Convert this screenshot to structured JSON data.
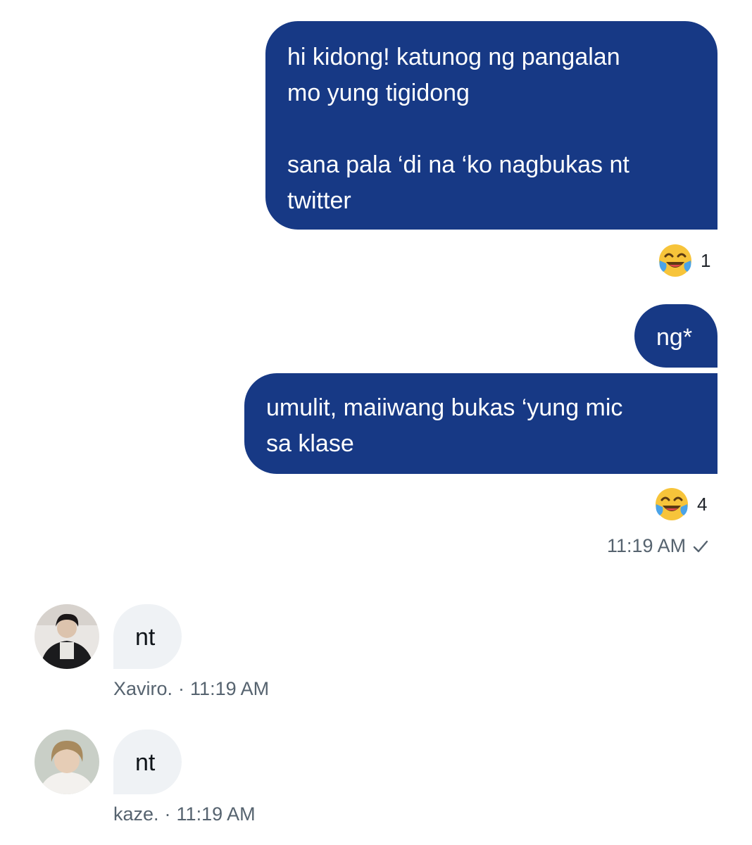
{
  "messages_sent": [
    {
      "text": "hi kidong! katunog ng pangalan\nmo yung tigidong\n\nsana pala ‘di na ‘ko nagbukas nt\ntwitter"
    },
    {
      "text": "ng*"
    },
    {
      "text": "umulit, maiiwang bukas ‘yung mic\nsa klase"
    }
  ],
  "reactions": [
    {
      "emoji": "face-with-tears-of-joy-icon",
      "count": "1"
    },
    {
      "emoji": "face-with-tears-of-joy-icon",
      "count": "4"
    }
  ],
  "sent_timestamp": "11:19 AM",
  "messages_received": [
    {
      "sender": "Xaviro.",
      "separator": "·",
      "time": "11:19 AM",
      "text": "nt"
    },
    {
      "sender": "kaze.",
      "separator": "·",
      "time": "11:19 AM",
      "text": "nt"
    }
  ],
  "colors": {
    "sent_bubble": "#173985",
    "received_bubble": "#eff2f5",
    "meta_text": "#56636f"
  }
}
